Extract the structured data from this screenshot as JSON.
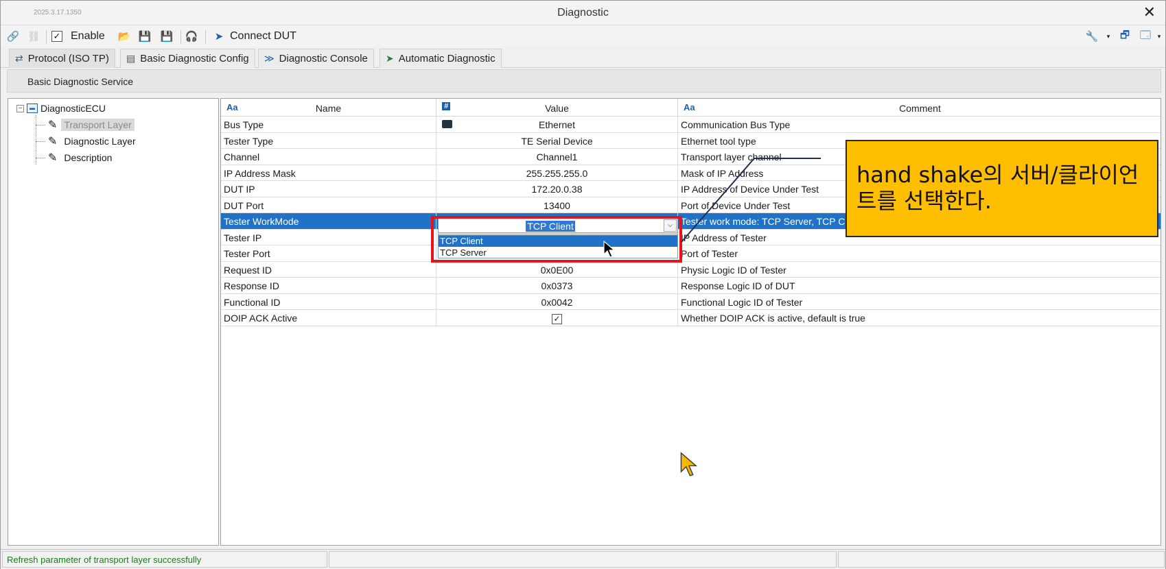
{
  "window": {
    "version": "2025.3.17.1350",
    "title": "Diagnostic",
    "close_glyph": "✕"
  },
  "toolbar": {
    "enable_checked": true,
    "enable_label": "Enable",
    "connect_label": "Connect DUT"
  },
  "tabs": [
    {
      "label": "Protocol (ISO TP)",
      "icon": "protocol-icon",
      "active": true
    },
    {
      "label": "Basic Diagnostic Config",
      "icon": "window-icon",
      "active": false
    },
    {
      "label": "Diagnostic Console",
      "icon": "console-icon",
      "active": false
    },
    {
      "label": "Automatic Diagnostic",
      "icon": "send-icon",
      "active": false
    }
  ],
  "service_header": "Basic Diagnostic Service",
  "tree": {
    "root": "DiagnosticECU",
    "items": [
      {
        "label": "Transport Layer",
        "selected": true
      },
      {
        "label": "Diagnostic Layer",
        "selected": false
      },
      {
        "label": "Description",
        "selected": false
      }
    ]
  },
  "grid": {
    "columns": {
      "name": "Name",
      "value": "Value",
      "comment": "Comment",
      "name_icon": "Aa",
      "value_icon": "#",
      "comment_icon": "Aa"
    },
    "rows": [
      {
        "name": "Bus Type",
        "value": "Ethernet",
        "comment": "Communication Bus Type"
      },
      {
        "name": "Tester Type",
        "value": "TE Serial Device",
        "comment": "Ethernet tool type"
      },
      {
        "name": "Channel",
        "value": "Channel1",
        "comment": "Transport layer channel"
      },
      {
        "name": "IP Address Mask",
        "value": "255.255.255.0",
        "comment": "Mask of IP Address"
      },
      {
        "name": "DUT IP",
        "value": "172.20.0.38",
        "comment": "IP Address of Device Under Test"
      },
      {
        "name": "DUT Port",
        "value": "13400",
        "comment": "Port of Device Under Test"
      },
      {
        "name": "Tester WorkMode",
        "value": "TCP Client",
        "comment": "Tester work mode: TCP Server, TCP Cl"
      },
      {
        "name": "Tester IP",
        "value": "",
        "comment": "IP Address of Tester"
      },
      {
        "name": "Tester Port",
        "value": "",
        "comment": "Port of Tester"
      },
      {
        "name": "Request ID",
        "value": "0x0E00",
        "comment": "Physic Logic ID of Tester"
      },
      {
        "name": "Response ID",
        "value": "0x0373",
        "comment": "Response Logic ID of DUT"
      },
      {
        "name": "Functional ID",
        "value": "0x0042",
        "comment": "Functional Logic ID of Tester"
      },
      {
        "name": "DOIP ACK Active",
        "value": "",
        "comment": "Whether DOIP ACK is active, default is true"
      }
    ],
    "doip_ack_checked": true
  },
  "workmode_dropdown": {
    "selected": "TCP Client",
    "options": [
      "TCP Client",
      "TCP Server"
    ]
  },
  "callout": {
    "text": "hand shake의 서버/클라이언트를 선택한다.",
    "color": "#ffbf00"
  },
  "status": {
    "message": "Refresh parameter of transport layer successfully"
  }
}
